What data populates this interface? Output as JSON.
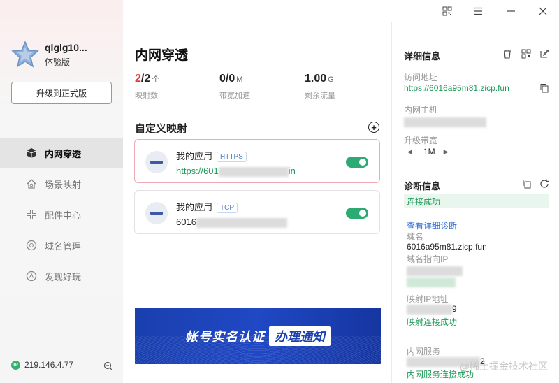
{
  "sidebar": {
    "username": "qlglg10...",
    "plan": "体验版",
    "upgrade_label": "升级到正式版",
    "items": [
      {
        "label": "内网穿透",
        "icon": "cube-icon"
      },
      {
        "label": "场景映射",
        "icon": "home-icon"
      },
      {
        "label": "配件中心",
        "icon": "grid-icon"
      },
      {
        "label": "域名管理",
        "icon": "globe-icon"
      },
      {
        "label": "发现好玩",
        "icon": "compass-icon"
      }
    ],
    "ip": "219.146.4.77",
    "ip_badge": "IP"
  },
  "main": {
    "title": "内网穿透",
    "stats": [
      {
        "num_red": "2",
        "num_rest": "/2",
        "unit": "个",
        "label": "映射数"
      },
      {
        "num_red": "",
        "num_rest": "0/0",
        "unit": "M",
        "label": "带宽加速"
      },
      {
        "num_red": "",
        "num_rest": "1.00",
        "unit": "G",
        "label": "剩余流量"
      }
    ],
    "section_title": "自定义映射",
    "cards": [
      {
        "name": "我的应用",
        "tag": "HTTPS",
        "url_prefix": "https://601",
        "url_suffix": "in"
      },
      {
        "name": "我的应用",
        "tag": "TCP",
        "url_prefix": "6016",
        "url_suffix": ""
      }
    ],
    "banner_text": "帐号实名认证",
    "banner_badge": "办理通知"
  },
  "details": {
    "title": "详细信息",
    "access_label": "访问地址",
    "access_value": "https://6016a95m81.zicp.fun",
    "host_label": "内网主机",
    "bandwidth_label": "升级带宽",
    "bandwidth_value": "1M"
  },
  "diagnosis": {
    "title": "诊断信息",
    "status": "连接成功",
    "detail_link": "查看详细诊断",
    "domain_label": "域名",
    "domain_value": "6016a95m81.zicp.fun",
    "domain_ip_label": "域名指向IP",
    "mapping_ip_label": "映射IP地址",
    "mapping_ip_suffix": "9",
    "mapping_status": "映射连接成功",
    "service_label": "内网服务",
    "service_suffix": "2",
    "service_status": "内网服务连接成功"
  },
  "watermark": "@稀土掘金技术社区"
}
